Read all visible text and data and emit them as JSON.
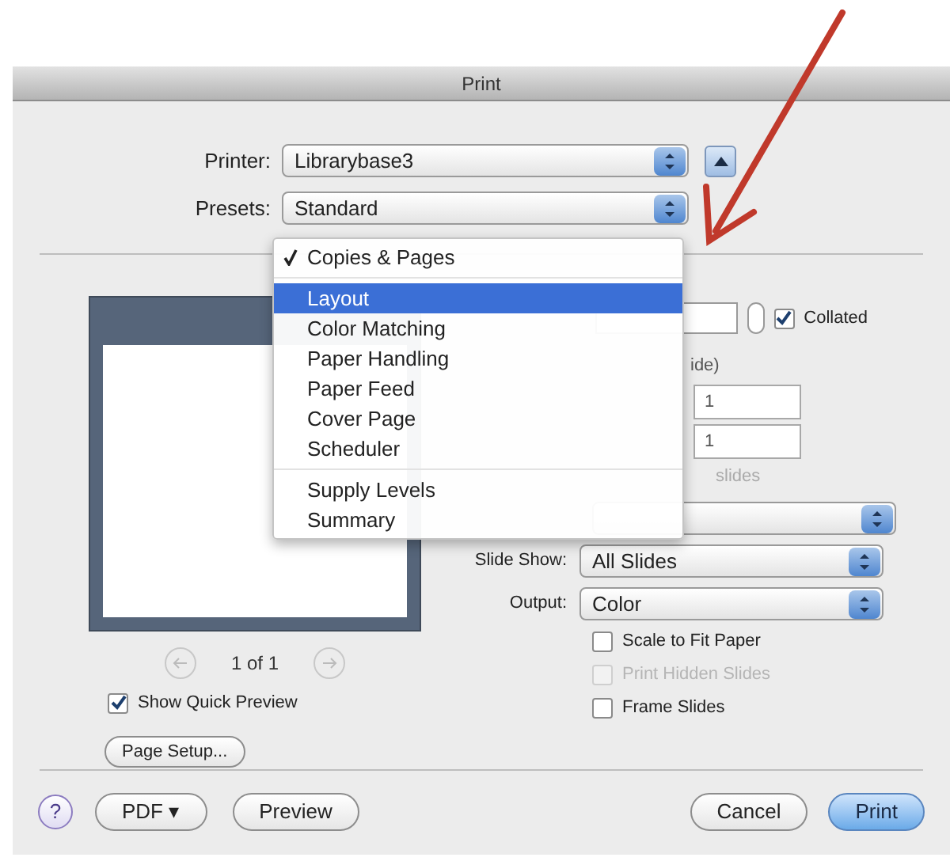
{
  "window": {
    "title": "Print"
  },
  "printer": {
    "label": "Printer:",
    "value": "Librarybase3"
  },
  "presets": {
    "label": "Presets:",
    "value": "Standard"
  },
  "panel_menu": {
    "sections": [
      [
        {
          "label": "Copies & Pages",
          "checked": true,
          "highlighted": false
        }
      ],
      [
        {
          "label": "Layout",
          "checked": false,
          "highlighted": true
        },
        {
          "label": "Color Matching",
          "checked": false,
          "highlighted": false
        },
        {
          "label": "Paper Handling",
          "checked": false,
          "highlighted": false
        },
        {
          "label": "Paper Feed",
          "checked": false,
          "highlighted": false
        },
        {
          "label": "Cover Page",
          "checked": false,
          "highlighted": false
        },
        {
          "label": "Scheduler",
          "checked": false,
          "highlighted": false
        }
      ],
      [
        {
          "label": "Supply Levels",
          "checked": false,
          "highlighted": false
        },
        {
          "label": "Summary",
          "checked": false,
          "highlighted": false
        }
      ]
    ]
  },
  "preview": {
    "page_label": "1 of 1",
    "show_quick_preview": {
      "label": "Show Quick Preview",
      "checked": true
    },
    "page_setup_button": "Page Setup..."
  },
  "copies": {
    "collated": {
      "label": "Collated",
      "checked": true
    }
  },
  "pages": {
    "note": "ide)",
    "from_value": "1",
    "to_value": "1",
    "slides_note": "slides"
  },
  "select_rows": [
    {
      "label": "Slide Show:",
      "value": "All Slides"
    },
    {
      "label": "Output:",
      "value": "Color"
    }
  ],
  "options": [
    {
      "label": "Scale to Fit Paper",
      "checked": false,
      "disabled": false
    },
    {
      "label": "Print Hidden Slides",
      "checked": false,
      "disabled": true
    },
    {
      "label": "Frame Slides",
      "checked": false,
      "disabled": false
    }
  ],
  "footer": {
    "help": "?",
    "left_buttons": [
      {
        "label": "PDF ▾",
        "default": false
      },
      {
        "label": "Preview",
        "default": false
      }
    ],
    "right_buttons": [
      {
        "label": "Cancel",
        "default": false
      },
      {
        "label": "Print",
        "default": true
      }
    ]
  }
}
